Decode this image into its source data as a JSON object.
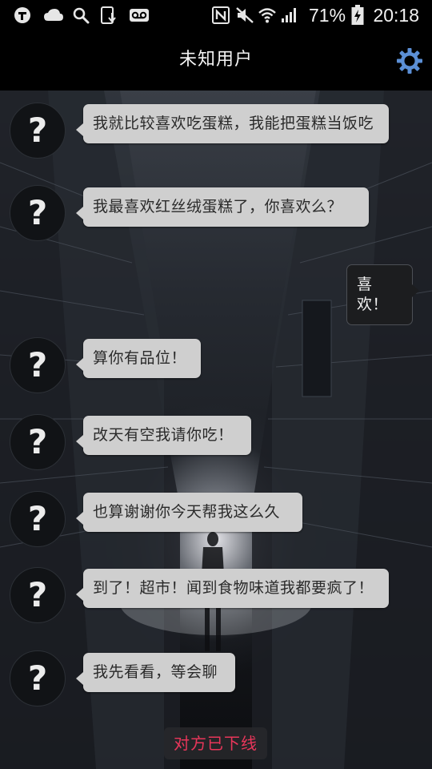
{
  "status_bar": {
    "battery_percent": "71%",
    "time": "20:18",
    "icons": [
      "notification-app-icon",
      "cloud-icon",
      "search-icon",
      "download-icon",
      "voicemail-icon",
      "nfc-icon",
      "mute-icon",
      "wifi-icon",
      "signal-icon",
      "battery-charging-icon"
    ]
  },
  "app_bar": {
    "title": "未知用户",
    "settings_icon": "gear-icon",
    "accent_color": "#5b8fd6"
  },
  "messages": [
    {
      "side": "left",
      "text": "我就比较喜欢吃蛋糕，我能把蛋糕当饭吃",
      "avatar": "?"
    },
    {
      "side": "left",
      "text": "我最喜欢红丝绒蛋糕了，你喜欢么？",
      "avatar": "?"
    },
    {
      "side": "right",
      "text": "喜欢！"
    },
    {
      "side": "left",
      "text": "算你有品位！",
      "avatar": "?"
    },
    {
      "side": "left",
      "text": "改天有空我请你吃！",
      "avatar": "?"
    },
    {
      "side": "left",
      "text": "也算谢谢你今天帮我这么久",
      "avatar": "?"
    },
    {
      "side": "left",
      "text": "到了！超市！闻到食物味道我都要疯了！",
      "avatar": "?"
    },
    {
      "side": "left",
      "text": "我先看看，等会聊",
      "avatar": "?"
    }
  ],
  "footer": {
    "offline_notice": "对方已下线",
    "offline_color": "#e8365a"
  }
}
